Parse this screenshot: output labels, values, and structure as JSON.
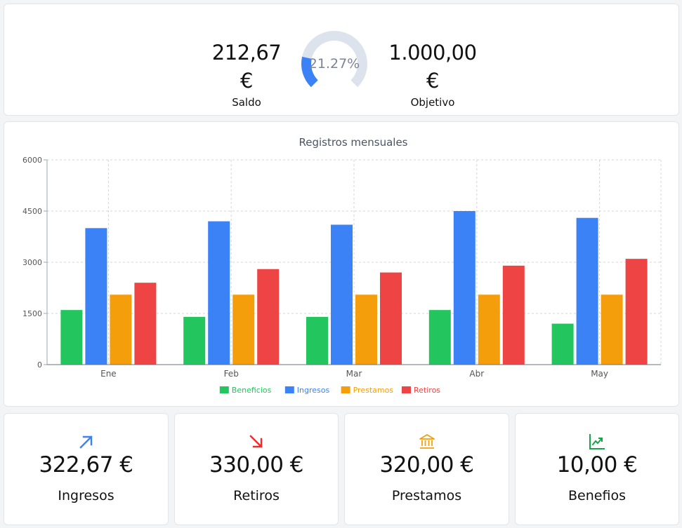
{
  "summary": {
    "saldo_value": "212,67 €",
    "saldo_label": "Saldo",
    "objetivo_value": "1.000,00 €",
    "objetivo_label": "Objetivo",
    "progress_text": "21.27%",
    "progress_fraction": 0.2127,
    "colors": {
      "progress": "#3b82f6",
      "track": "#dde3ec",
      "text": "#7c8494"
    }
  },
  "chart_data": {
    "type": "bar",
    "title": "Registros mensuales",
    "categories": [
      "Ene",
      "Feb",
      "Mar",
      "Abr",
      "May"
    ],
    "ylim": [
      0,
      6000
    ],
    "yticks": [
      0,
      1500,
      3000,
      4500,
      6000
    ],
    "grid": true,
    "legend_position": "bottom",
    "series": [
      {
        "name": "Beneficios",
        "color": "#22c55e",
        "values": [
          1600,
          1400,
          1400,
          1600,
          1200
        ]
      },
      {
        "name": "Ingresos",
        "color": "#3b82f6",
        "values": [
          4000,
          4200,
          4100,
          4500,
          4300
        ]
      },
      {
        "name": "Prestamos",
        "color": "#f59e0b",
        "values": [
          2050,
          2050,
          2050,
          2050,
          2050
        ]
      },
      {
        "name": "Retiros",
        "color": "#ef4444",
        "values": [
          2400,
          2800,
          2700,
          2900,
          3100
        ]
      }
    ]
  },
  "stats": [
    {
      "icon": "arrow-up-right-icon",
      "color": "#3b82f6",
      "value": "322,67 €",
      "label": "Ingresos"
    },
    {
      "icon": "arrow-down-right-icon",
      "color": "#ef2b2b",
      "value": "330,00 €",
      "label": "Retiros"
    },
    {
      "icon": "bank-icon",
      "color": "#f59e0b",
      "value": "320,00 €",
      "label": "Prestamos"
    },
    {
      "icon": "chart-trending-up-icon",
      "color": "#16a34a",
      "value": "10,00 €",
      "label": "Benefios"
    }
  ]
}
